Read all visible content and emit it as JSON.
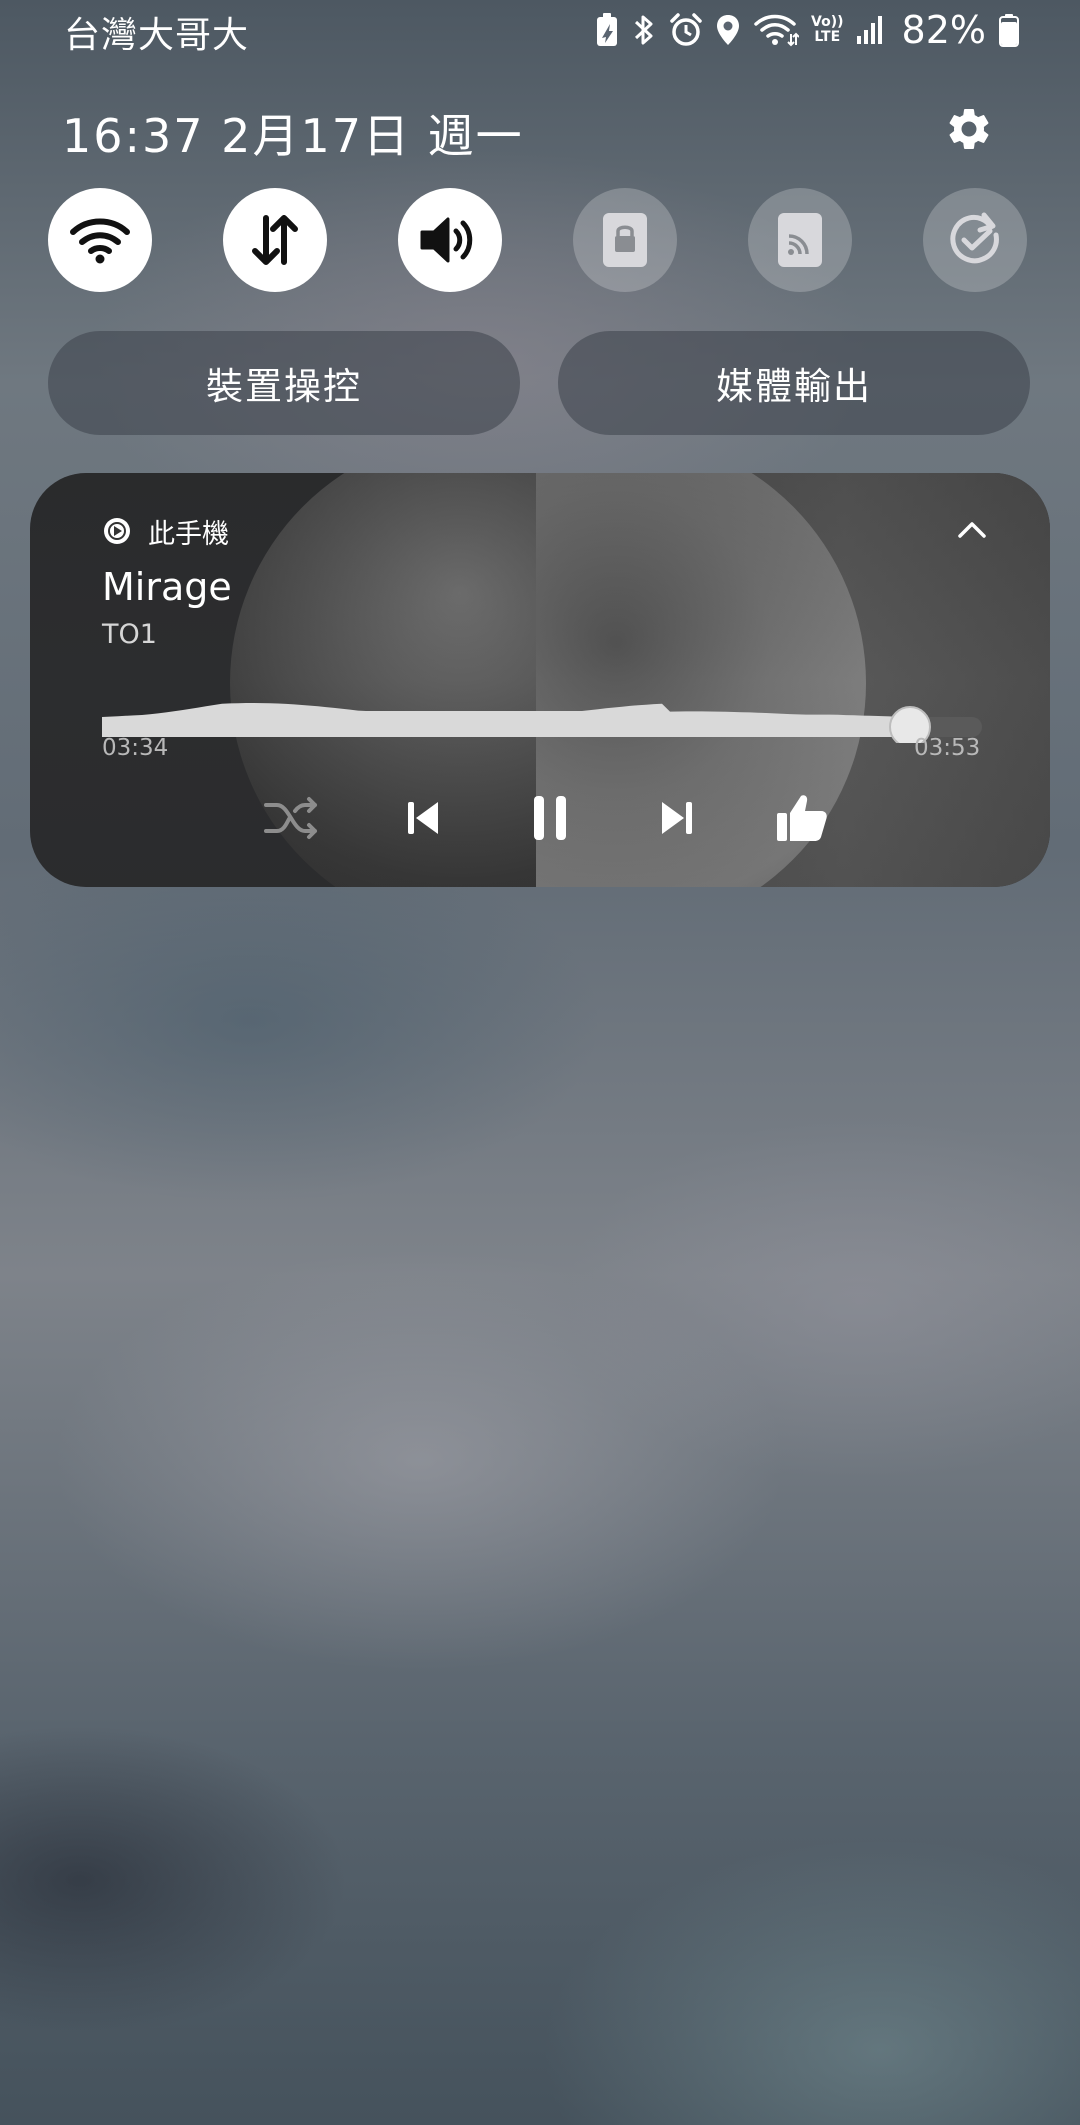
{
  "status_bar": {
    "carrier": "台灣大哥大",
    "battery_text": "82%",
    "battery_level": 0.82,
    "icons": [
      "battery-saver-icon",
      "bluetooth-icon",
      "alarm-icon",
      "location-icon",
      "wifi-icon",
      "volte-icon",
      "signal-icon",
      "battery-icon"
    ],
    "volte_line1": "Vo))",
    "volte_line2": "LTE"
  },
  "header": {
    "datetime": "16:37  2月17日 週一",
    "settings_icon": "gear-icon"
  },
  "quick_toggles": [
    {
      "name": "wifi",
      "icon": "wifi-icon",
      "state": "on"
    },
    {
      "name": "mobile-data",
      "icon": "data-arrows-icon",
      "state": "on"
    },
    {
      "name": "sound",
      "icon": "volume-icon",
      "state": "on"
    },
    {
      "name": "screen-lock",
      "icon": "lock-icon",
      "state": "off"
    },
    {
      "name": "cast",
      "icon": "cast-icon",
      "state": "off"
    },
    {
      "name": "sync",
      "icon": "sync-check-icon",
      "state": "off"
    }
  ],
  "buttons": {
    "device_control": "裝置操控",
    "media_output": "媒體輸出"
  },
  "media": {
    "source": "此手機",
    "title": "Mirage",
    "artist": "TO1",
    "elapsed": "03:34",
    "duration": "03:53",
    "progress": 0.918,
    "colors": {
      "track_fill": "#d9d9d9",
      "track_bg": "#5a5a5a",
      "card": "#2e2f31"
    }
  }
}
